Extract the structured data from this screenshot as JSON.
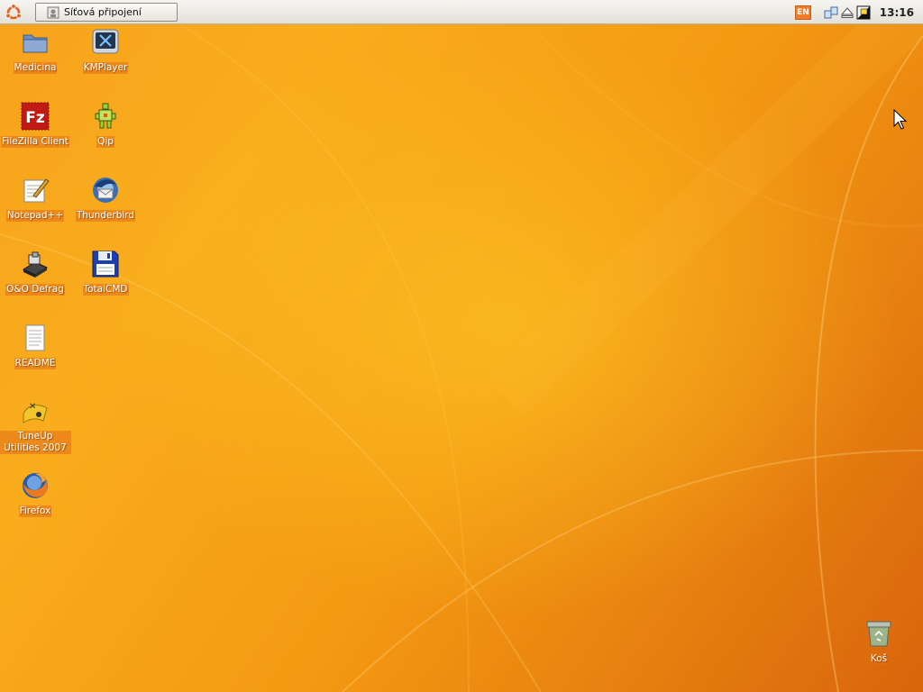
{
  "panel": {
    "task_button_label": "Síťová připojení",
    "keyboard_layout": "EN",
    "clock": "13:16"
  },
  "desktop_icons": [
    {
      "label": "Medicina",
      "icon": "folder-icon"
    },
    {
      "label": "KMPlayer",
      "icon": "kmplayer-icon"
    },
    {
      "label": "FileZilla Client",
      "icon": "filezilla-icon"
    },
    {
      "label": "Qip",
      "icon": "qip-icon"
    },
    {
      "label": "Notepad++",
      "icon": "notepad-icon"
    },
    {
      "label": "Thunderbird",
      "icon": "thunderbird-icon"
    },
    {
      "label": "O&O Defrag",
      "icon": "defrag-icon"
    },
    {
      "label": "TotalCMD",
      "icon": "floppy-disk-icon"
    },
    {
      "label": "README",
      "icon": "text-document-icon"
    },
    {
      "label": "TuneUp Utilities 2007",
      "icon": "tuneup-icon"
    },
    {
      "label": "Firefox",
      "icon": "firefox-icon"
    },
    {
      "label": "Koš",
      "icon": "trash-icon"
    }
  ],
  "colors": {
    "wallpaper": "#f7a21c",
    "panel": "#efede7",
    "label_bg": "#e26e19"
  }
}
